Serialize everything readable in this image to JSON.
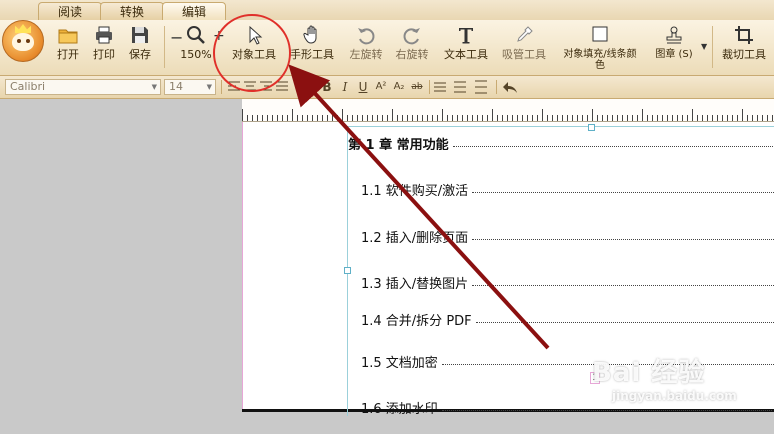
{
  "tabs": [
    {
      "label": "阅读"
    },
    {
      "label": "转换"
    },
    {
      "label": "编辑"
    }
  ],
  "toolbar": {
    "open": "打开",
    "print": "打印",
    "save": "保存",
    "zoom_level": "150%",
    "object_tool": "对象工具",
    "hand_tool": "手形工具",
    "rotate_left": "左旋转",
    "rotate_right": "右旋转",
    "text_tool": "文本工具",
    "eyedropper_tool": "吸管工具",
    "object_fill": "对象填充/线条颜色",
    "stamp": "图章 (S)",
    "crop_tool": "裁切工具"
  },
  "format": {
    "font_name": "Calibri",
    "font_size": "14",
    "bold": "B",
    "italic": "I",
    "underline": "U",
    "superscript": "A²",
    "subscript": "A₂",
    "strike": "ab"
  },
  "document": {
    "chapter": "第 1 章  常用功能",
    "items": [
      {
        "text": "1.1 软件购买/激活"
      },
      {
        "text": "1.2 插入/删除页面"
      },
      {
        "text": "1.3 插入/替换图片"
      },
      {
        "text": "1.4 合并/拆分 PDF"
      },
      {
        "text": "1.5 文档加密"
      },
      {
        "text": "1.6 添加水印"
      }
    ],
    "page_marker": "1"
  },
  "watermark": {
    "line1": "Bai 经验",
    "line2": "jingyan.baidu.com"
  },
  "colors": {
    "accent": "#e0302a",
    "arrow": "#8b1010",
    "frame": "#9bd0da"
  }
}
